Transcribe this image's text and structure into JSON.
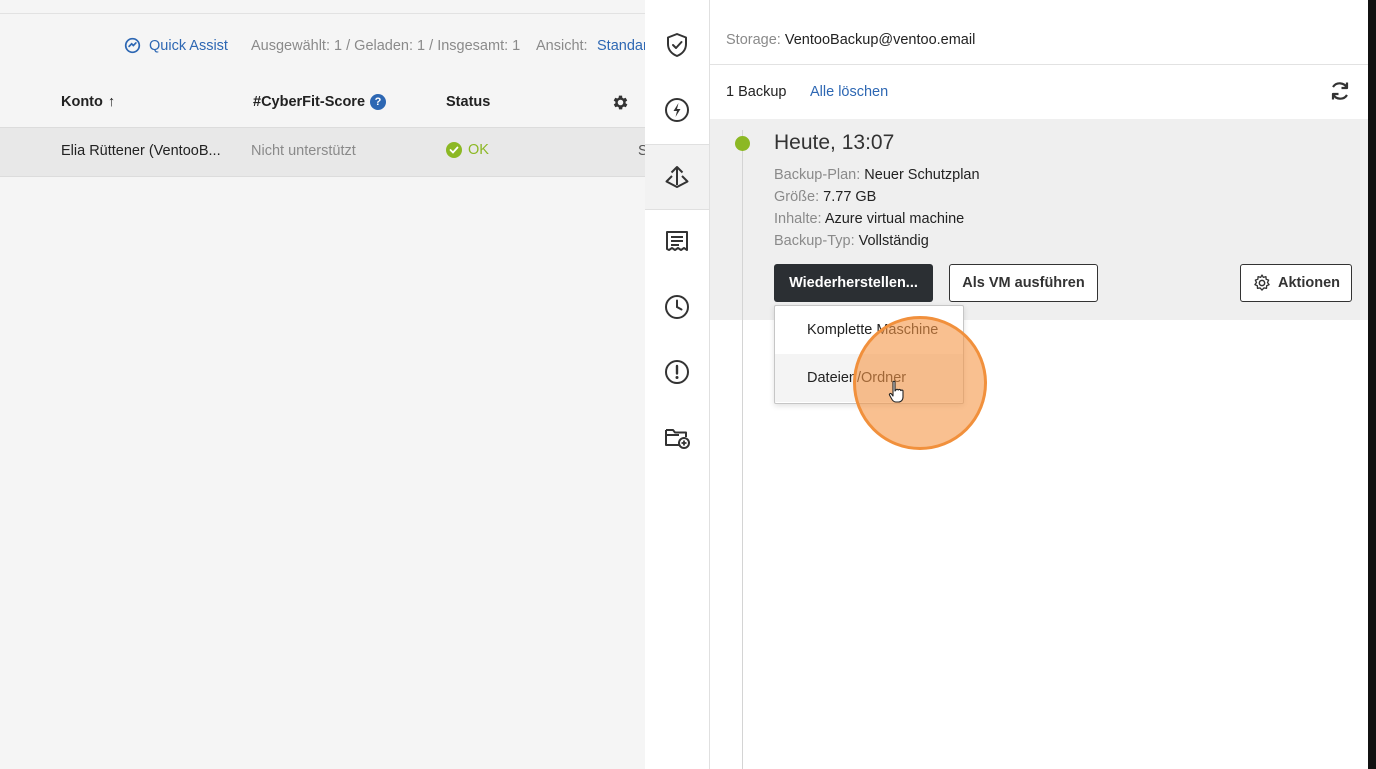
{
  "list": {
    "quick_assist": "Quick Assist",
    "counts": "Ausgewählt: 1 / Geladen: 1 / Insgesamt: 1",
    "view_label": "Ansicht:",
    "view_value": "Standar",
    "columns": {
      "konto": "Konto",
      "sort_arrow": "↑",
      "score": "#CyberFit-Score",
      "help": "?",
      "status": "Status"
    },
    "row": {
      "name": "Elia Rüttener (VentooB...",
      "score": "Nicht unterstützt",
      "status": "OK",
      "extra": "S"
    }
  },
  "panel": {
    "storage_label": "Storage:",
    "storage_value": "VentooBackup@ventoo.email",
    "backup_count": "1 Backup",
    "delete_all": "Alle löschen",
    "entry": {
      "title": "Heute, 13:07",
      "meta": [
        {
          "label": "Backup-Plan:",
          "value": "Neuer Schutzplan"
        },
        {
          "label": "Größe:",
          "value": "7.77 GB"
        },
        {
          "label": "Inhalte:",
          "value": "Azure virtual machine"
        },
        {
          "label": "Backup-Typ:",
          "value": "Vollständig"
        }
      ],
      "buttons": {
        "restore": "Wiederherstellen...",
        "run_vm": "Als VM ausführen",
        "actions": "Aktionen"
      },
      "dropdown": [
        "Komplette Maschine",
        "Dateien/Ordner"
      ]
    },
    "sidebar_icons": [
      "shield-check-icon",
      "lightning-icon",
      "backup-upload-icon",
      "receipt-icon",
      "clock-icon",
      "alert-icon",
      "folder-add-icon"
    ]
  },
  "colors": {
    "accent": "#2d67b3",
    "ok_green": "#8cb824",
    "dark_button": "#2b2f33",
    "highlight": "#f1903c"
  }
}
